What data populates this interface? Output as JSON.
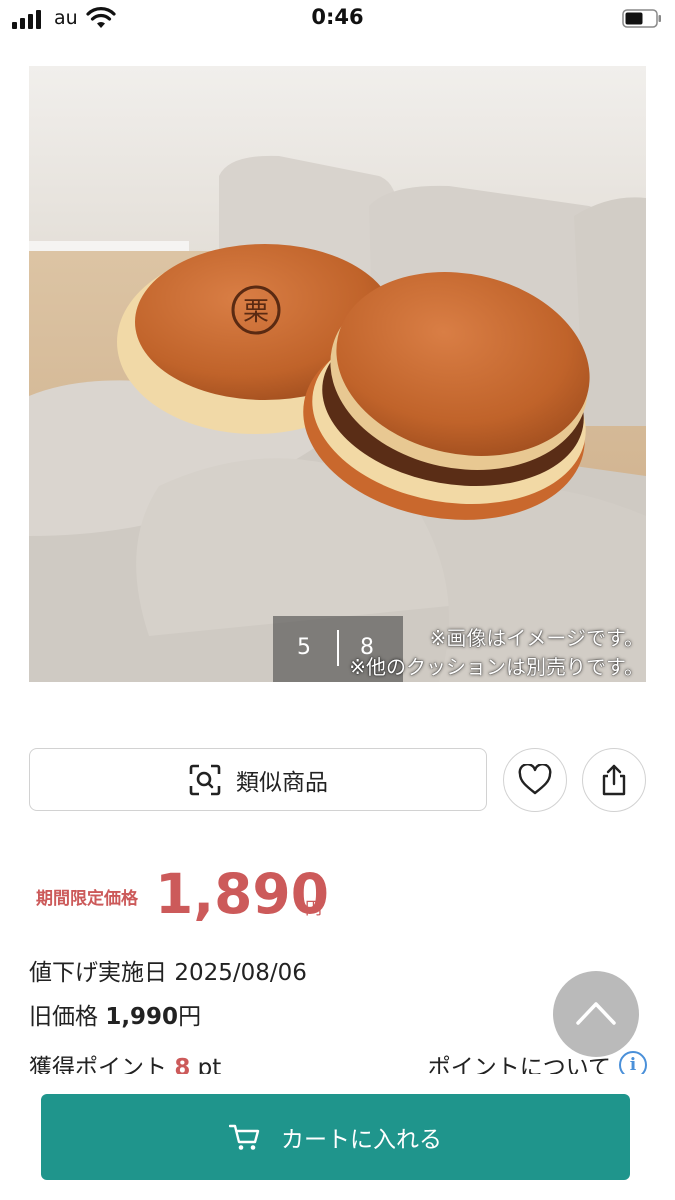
{
  "status_bar": {
    "carrier": "au",
    "time": "0:46"
  },
  "gallery": {
    "current": "5",
    "total": "8",
    "note1": "※画像はイメージです。",
    "note2": "※他のクッションは別売りです。",
    "emblem_char": "栗"
  },
  "actions": {
    "similar_label": "類似商品"
  },
  "price": {
    "label": "期間限定価格",
    "value": "1,890",
    "unit": "円"
  },
  "details": {
    "date_label": "値下げ実施日",
    "date_value": "2025/08/06",
    "old_price_label": "旧価格",
    "old_price_value": "1,990",
    "old_price_unit": "円",
    "points_label": "獲得ポイント",
    "points_value": "8",
    "points_unit": "pt",
    "points_link": "ポイントについて"
  },
  "cart": {
    "label": "カートに入れる"
  },
  "icons": {
    "signal": "signal-icon",
    "wifi": "wifi-icon",
    "battery": "battery-icon",
    "similar": "image-search-icon",
    "favorite": "heart-icon",
    "share": "share-icon",
    "info": "info-icon",
    "scroll_top": "chevron-up-icon",
    "cart": "cart-icon"
  },
  "colors": {
    "accent_price": "#cc5a5a",
    "cart_button": "#1f958c",
    "info_blue": "#4a90d9"
  }
}
